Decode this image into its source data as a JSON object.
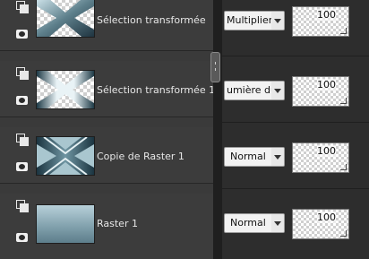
{
  "layers": [
    {
      "name": "Sélection transformée",
      "blend": "Multiplier",
      "opacity": "100",
      "thumb": "x-pattern-dark"
    },
    {
      "name": "Sélection transformée 1",
      "blend": "umière dur",
      "opacity": "100",
      "thumb": "x-pattern-light"
    },
    {
      "name": "Copie de Raster 1",
      "blend": "Normal",
      "opacity": "100",
      "thumb": "x-pattern-solid"
    },
    {
      "name": "Raster 1",
      "blend": "Normal",
      "opacity": "100",
      "thumb": "gradient"
    }
  ],
  "colors": {
    "panel_bg": "#3c3c3c",
    "thumb_dark": "#2f4a55",
    "thumb_light": "#cfe3ea"
  }
}
